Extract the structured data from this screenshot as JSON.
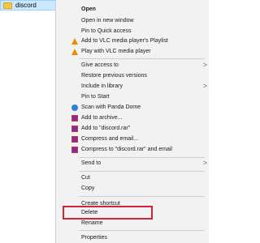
{
  "explorer": {
    "selected_item": "discord"
  },
  "context_menu": {
    "items": [
      {
        "label": "Open",
        "bold": true
      },
      {
        "label": "Open in new window"
      },
      {
        "label": "Pin to Quick access"
      },
      {
        "label": "Add to VLC media player's Playlist",
        "icon": "vlc-icon"
      },
      {
        "label": "Play with VLC media player",
        "icon": "vlc-icon"
      },
      {
        "label": "Give access to",
        "submenu": true
      },
      {
        "label": "Restore previous versions"
      },
      {
        "label": "Include in library",
        "submenu": true
      },
      {
        "label": "Pin to Start"
      },
      {
        "label": "Scan with Panda Dome",
        "icon": "panda-dome-icon"
      },
      {
        "label": "Add to archive...",
        "icon": "winrar-icon"
      },
      {
        "label": "Add to \"discord.rar\"",
        "icon": "winrar-icon"
      },
      {
        "label": "Compress and email...",
        "icon": "winrar-icon"
      },
      {
        "label": "Compress to \"discord.rar\" and email",
        "icon": "winrar-icon"
      },
      {
        "label": "Send to",
        "submenu": true
      },
      {
        "label": "Cut"
      },
      {
        "label": "Copy"
      },
      {
        "label": "Create shortcut"
      },
      {
        "label": "Delete",
        "highlighted": true
      },
      {
        "label": "Rename"
      },
      {
        "label": "Properties"
      }
    ],
    "submenu_arrow": ">",
    "highlight_color": "#d0243a"
  }
}
